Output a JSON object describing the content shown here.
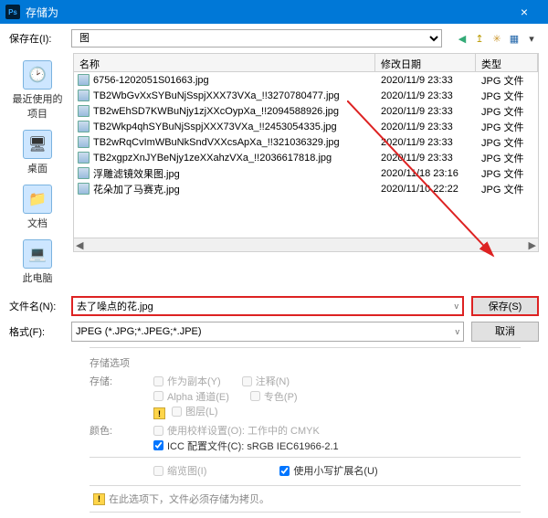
{
  "titlebar": {
    "title": "存储为",
    "close": "×"
  },
  "toprow": {
    "label": "保存在(I):",
    "folder": "图",
    "icons": {
      "back": "◀",
      "up": "↥",
      "new": "✳",
      "view": "▦",
      "menu": "▾"
    }
  },
  "sidebar": [
    {
      "label": "最近使用的项目",
      "glyph": "🕑"
    },
    {
      "label": "桌面",
      "glyph": "🖥"
    },
    {
      "label": "文档",
      "glyph": "📁"
    },
    {
      "label": "此电脑",
      "glyph": "💻"
    }
  ],
  "columns": {
    "name": "名称",
    "date": "修改日期",
    "type": "类型"
  },
  "files": [
    {
      "name": "6756-1202051S01663.jpg",
      "date": "2020/11/9 23:33",
      "type": "JPG 文件"
    },
    {
      "name": "TB2WbGvXxSYBuNjSspjXXX73VXa_!!3270780477.jpg",
      "date": "2020/11/9 23:33",
      "type": "JPG 文件"
    },
    {
      "name": "TB2wEhSD7KWBuNjy1zjXXcOypXa_!!2094588926.jpg",
      "date": "2020/11/9 23:33",
      "type": "JPG 文件"
    },
    {
      "name": "TB2Wkp4qhSYBuNjSspjXXX73VXa_!!2453054335.jpg",
      "date": "2020/11/9 23:33",
      "type": "JPG 文件"
    },
    {
      "name": "TB2wRqCvImWBuNkSndVXXcsApXa_!!321036329.jpg",
      "date": "2020/11/9 23:33",
      "type": "JPG 文件"
    },
    {
      "name": "TB2xgpzXnJYBeNjy1zeXXahzVXa_!!2036617818.jpg",
      "date": "2020/11/9 23:33",
      "type": "JPG 文件"
    },
    {
      "name": "浮雕滤镜效果图.jpg",
      "date": "2020/11/18 23:16",
      "type": "JPG 文件"
    },
    {
      "name": "花朵加了马赛克.jpg",
      "date": "2020/11/10 22:22",
      "type": "JPG 文件"
    }
  ],
  "form": {
    "filename_label": "文件名(N):",
    "filename_value": "去了噪点的花.jpg",
    "format_label": "格式(F):",
    "format_value": "JPEG (*.JPG;*.JPEG;*.JPE)",
    "save_btn": "保存(S)",
    "cancel_btn": "取消"
  },
  "options": {
    "heading": "存储选项",
    "store_label": "存储:",
    "as_copy": "作为副本(Y)",
    "notes": "注释(N)",
    "alpha": "Alpha 通道(E)",
    "spot": "专色(P)",
    "layers": "图层(L)",
    "color_label": "颜色:",
    "proof": "使用校样设置(O): 工作中的 CMYK",
    "icc": "ICC 配置文件(C): sRGB IEC61966-2.1",
    "thumb": "缩览图(I)",
    "lc_ext": "使用小写扩展名(U)",
    "note": "在此选项下，文件必须存储为拷贝。"
  }
}
